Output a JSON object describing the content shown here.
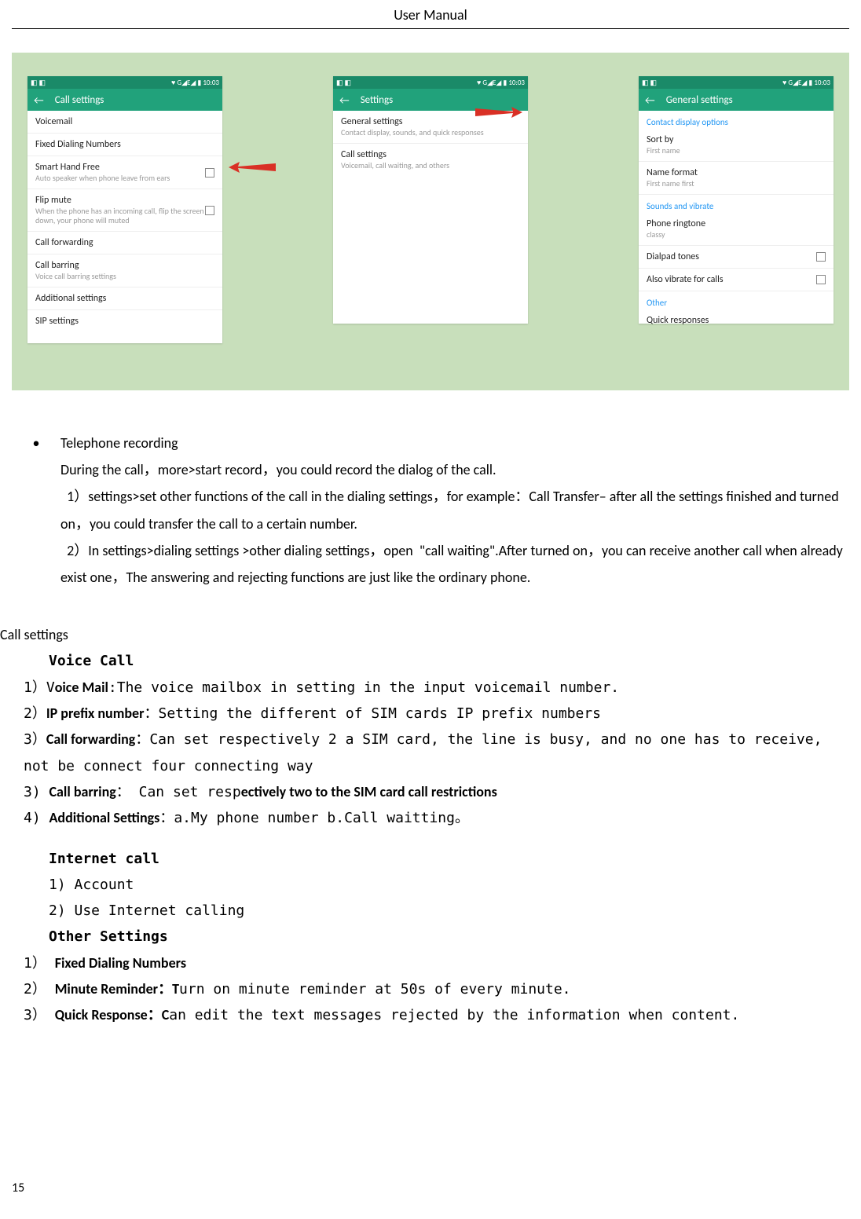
{
  "header": "User    Manual",
  "page_number": "15",
  "screenshots": {
    "statusbar_left": "◧ ◧",
    "statusbar_right": "♥ G◢E◢ ▮ 10:03",
    "s1": {
      "title": "Call settings",
      "rows": {
        "voicemail": "Voicemail",
        "fdn": "Fixed Dialing Numbers",
        "shf_t": "Smart Hand Free",
        "shf_s": "Auto speaker when phone leave from ears",
        "flip_t": "Flip mute",
        "flip_s": "When the phone has an incoming call, flip the screen down, your phone will muted",
        "cf": "Call forwarding",
        "cb_t": "Call barring",
        "cb_s": "Voice call barring settings",
        "add": "Additional settings",
        "sip": "SIP settings"
      }
    },
    "s2": {
      "title": "Settings",
      "gs_t": "General settings",
      "gs_s": "Contact display, sounds, and quick responses",
      "cs_t": "Call settings",
      "cs_s": "Voicemail, call waiting, and others"
    },
    "s3": {
      "title": "General settings",
      "h1": "Contact display options",
      "sort_t": "Sort by",
      "sort_s": "First name",
      "nf_t": "Name format",
      "nf_s": "First name first",
      "h2": "Sounds and vibrate",
      "ring_t": "Phone ringtone",
      "ring_s": "classy",
      "dial": "Dialpad tones",
      "vib": "Also vibrate for calls",
      "h3": "Other",
      "qr": "Quick responses"
    }
  },
  "bullet": {
    "title": "Telephone recording",
    "p1": "During the call，more>start record，you could record the dialog of the call.",
    "p2": "  1）settings>set other functions of the call in the dialing settings，for example：Call Transfer– after all the settings finished and turned on，you could transfer the call to a certain number.",
    "p3": "  2）In settings>dialing settings >other dialing settings，open  \"call waiting\".After turned on，you can receive another call when already exist one，The answering and rejecting functions are just like the ordinary phone."
  },
  "cs": {
    "heading": "Call settings",
    "voice_call": "Voice Call",
    "l1a": "1）V",
    "l1b": "oice Mail",
    "l1c": ":The voice mailbox in setting in the input voicemail number.",
    "l2a": "2）",
    "l2b": "IP prefix number",
    "l2c": "：Setting the different of SIM cards IP prefix numbers",
    "l3a": "3）",
    "l3b": "Call forwarding",
    "l3c": "：Can set respectively 2 a SIM card, the line is busy, and no one has to receive, not be connect four connecting way",
    "l4a": "3) ",
    "l4b": "Call barring",
    "l4c": "： Can set resp",
    "l4d": "ectively two to the SIM card call restrictions",
    "l5a": "4) ",
    "l5b": "Additional Settings",
    "l5c": "：a.My phone number b.Call waitting。",
    "internet": "Internet call",
    "i1": "1)  Account",
    "i2": "2)  Use Internet calling",
    "other": "Other Settings",
    "o1a": "1） ",
    "o1b": "Fixed Dialing Numbers",
    "o2a": "2） ",
    "o2b": "Minute Reminder",
    "o2c": "：T",
    "o2d": "urn on minute reminder at 50s of every minute.",
    "o3a": "3） ",
    "o3b": "Quick Response",
    "o3c": "：C",
    "o3d": "an edit the text messages rejected by the information when content."
  }
}
